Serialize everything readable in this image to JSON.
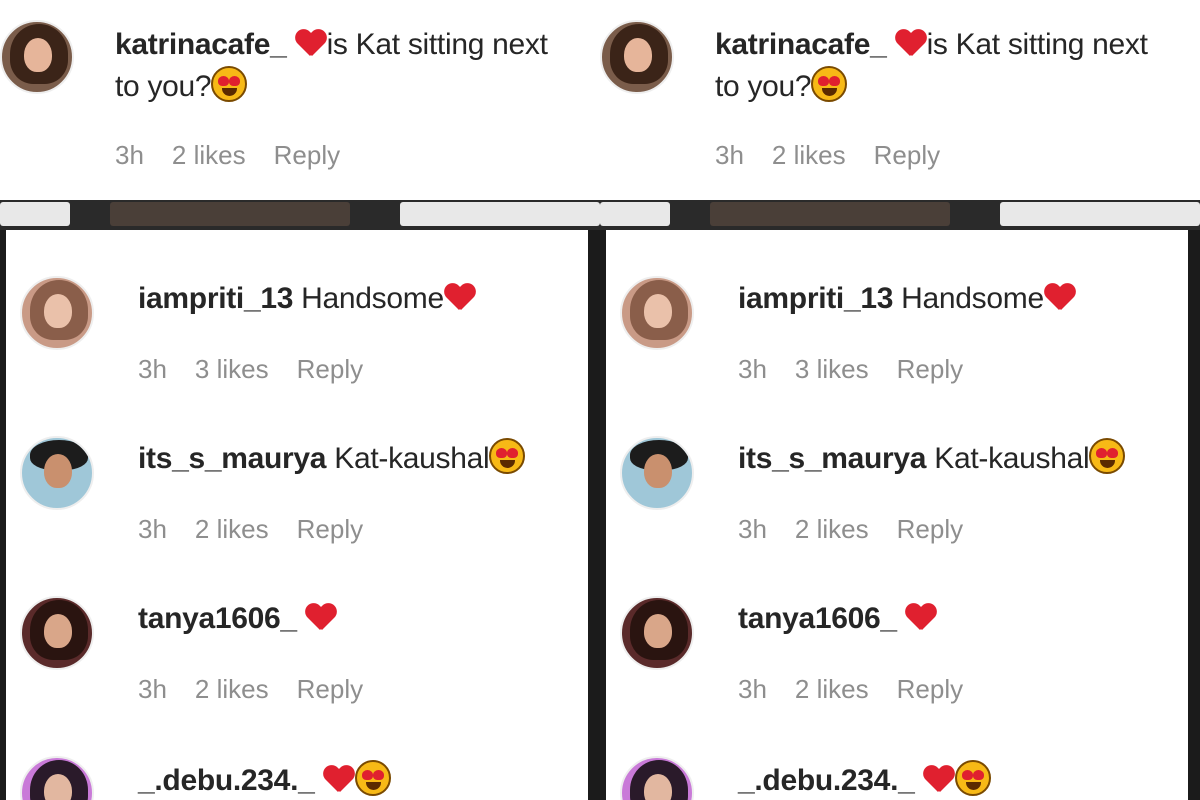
{
  "top_comment": {
    "username": "katrinacafe_",
    "text_line1": "is Kat sitting next",
    "text_line2": "to you?",
    "time": "3h",
    "likes": "2 likes",
    "reply": "Reply"
  },
  "comments": [
    {
      "username": "iampriti_13",
      "text": "Handsome",
      "time": "3h",
      "likes": "3 likes",
      "reply": "Reply"
    },
    {
      "username": "its_s_maurya",
      "text": "Kat-kaushal",
      "time": "3h",
      "likes": "2 likes",
      "reply": "Reply"
    },
    {
      "username": "tanya1606_",
      "text": "",
      "time": "3h",
      "likes": "2 likes",
      "reply": "Reply"
    },
    {
      "username": "_.debu.234._",
      "text": ""
    }
  ],
  "colors": {
    "text": "#262626",
    "meta": "#8e8e8e",
    "heart": "#e0202f",
    "emoji": "#f7b916"
  },
  "icons": [
    "red-heart-icon",
    "heart-eyes-emoji-icon"
  ]
}
